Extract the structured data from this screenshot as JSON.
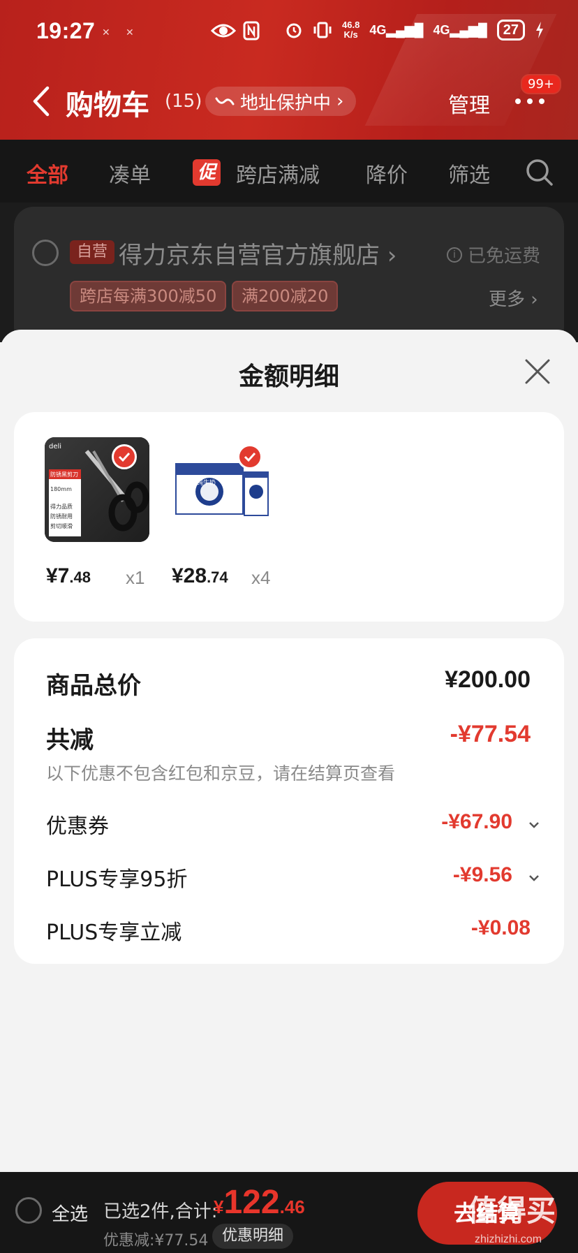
{
  "status_bar": {
    "time": "19:27",
    "net_speed_top": "46.8",
    "net_speed_bottom": "K/s",
    "sig1": "4G",
    "sig2": "4G",
    "battery": "27"
  },
  "nav": {
    "title": "购物车",
    "count": "(15)",
    "address_protect": "地址保护中",
    "manage": "管理",
    "more_badge": "99+"
  },
  "tabs": {
    "all": "全部",
    "combine": "凑单",
    "promo_tag": "促",
    "cross_store": "跨店满减",
    "price_drop": "降价",
    "filter": "筛选"
  },
  "store": {
    "self_badge": "自营",
    "name": "得力京东自营官方旗舰店",
    "free_shipping": "已免运费",
    "promo1": "跨店每满300减50",
    "promo2": "满200减20",
    "more": "更多"
  },
  "sheet": {
    "title": "金额明细",
    "items": [
      {
        "name": "scissors",
        "price_int": "¥7",
        "price_dec": ".48",
        "qty": "x1",
        "img_label": "防锈黑剪刀",
        "img_spec": "180mm",
        "img_feat1": "得力品质",
        "img_feat2": "防锈耐用",
        "img_feat3": "剪切顺滑"
      },
      {
        "name": "milk",
        "price_int": "¥28",
        "price_dec": ".74",
        "qty": "x4",
        "img_label": "纯牛奶"
      }
    ],
    "details": {
      "goods_total_label": "商品总价",
      "goods_total_value": "¥200.00",
      "total_reduce_label": "共减",
      "total_reduce_value": "-¥77.54",
      "note": "以下优惠不包含红包和京豆，请在结算页查看",
      "coupon_label": "优惠券",
      "coupon_value": "-¥67.90",
      "plus95_label": "PLUS专享95折",
      "plus95_value": "-¥9.56",
      "plus_reduce_label": "PLUS专享立减",
      "plus_reduce_value": "-¥0.08"
    }
  },
  "bottom": {
    "select_all": "全选",
    "selected": "已选2件,合计:",
    "total_yen": "¥",
    "total_int": "122",
    "total_dec": ".46",
    "discount": "优惠减:¥77.54",
    "detail_btn": "优惠明细",
    "checkout": "去结算",
    "watermark": "值得买",
    "watermark_url": "zhizhizhi.com"
  },
  "colors": {
    "accent_red": "#e23a2f",
    "header_red": "#c92a20"
  }
}
